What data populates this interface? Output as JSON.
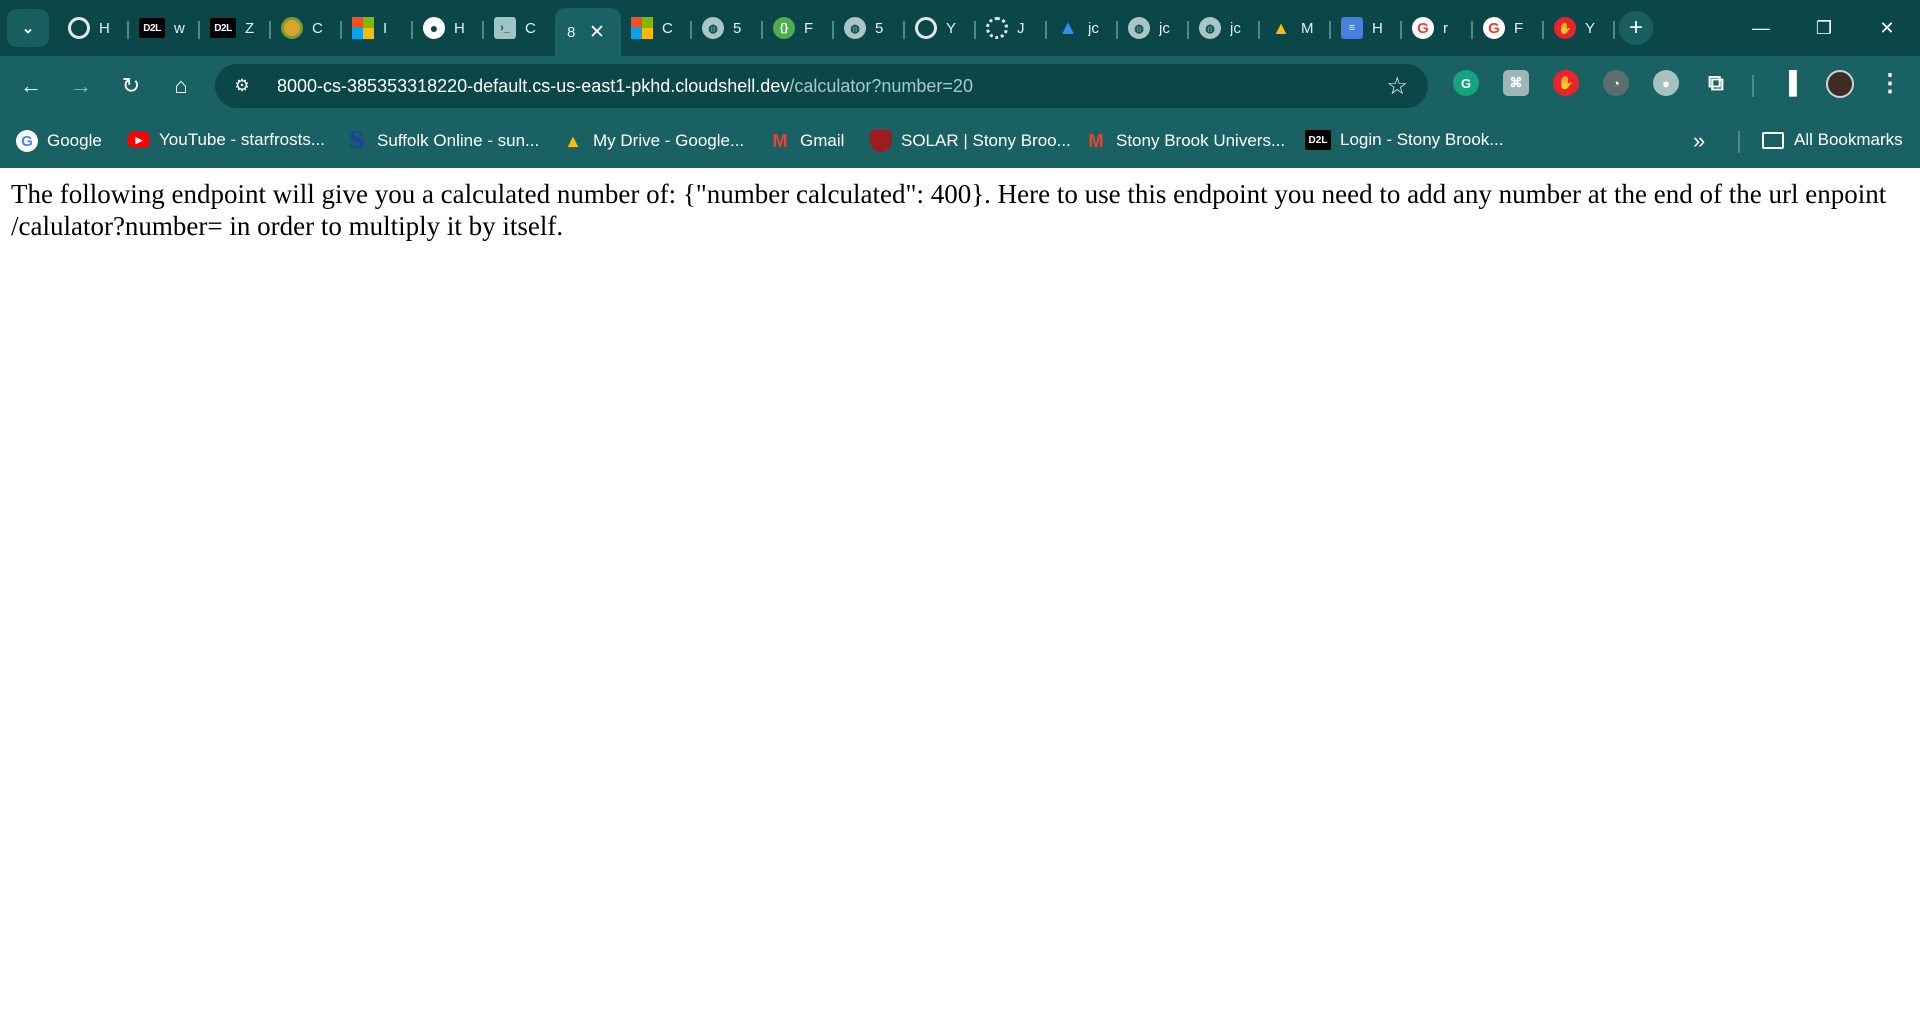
{
  "browser": {
    "tabs": [
      {
        "icon": "github-copilot-icon",
        "label": "H"
      },
      {
        "icon": "d2l-icon",
        "label": "w"
      },
      {
        "icon": "d2l-icon",
        "label": "Z"
      },
      {
        "icon": "target-icon",
        "label": "C"
      },
      {
        "icon": "microsoft-icon",
        "label": "I"
      },
      {
        "icon": "github-icon",
        "label": "H"
      },
      {
        "icon": "cloud-shell-icon",
        "label": "C"
      },
      {
        "icon": "none",
        "label": "8",
        "active": true
      },
      {
        "icon": "microsoft-icon",
        "label": "C"
      },
      {
        "icon": "globe-icon",
        "label": "5"
      },
      {
        "icon": "green-bracket-icon",
        "label": "F"
      },
      {
        "icon": "globe-icon",
        "label": "5"
      },
      {
        "icon": "github-copilot-icon",
        "label": "Y"
      },
      {
        "icon": "loading-ring-icon",
        "label": "J"
      },
      {
        "icon": "azure-icon",
        "label": "jc"
      },
      {
        "icon": "globe-icon",
        "label": "jc"
      },
      {
        "icon": "globe-icon",
        "label": "jc"
      },
      {
        "icon": "google-drive-icon",
        "label": "M"
      },
      {
        "icon": "google-docs-icon",
        "label": "H"
      },
      {
        "icon": "google-icon",
        "label": "r"
      },
      {
        "icon": "google-icon",
        "label": "F"
      },
      {
        "icon": "red-hand-icon",
        "label": "Y"
      }
    ],
    "close_glyph": "✕",
    "new_tab_glyph": "+",
    "window_controls": {
      "minimize": "—",
      "restore": "❐",
      "close": "✕"
    }
  },
  "toolbar": {
    "back": "←",
    "forward": "→",
    "reload": "↻",
    "home": "⌂",
    "url_host": "8000-cs-385353318220-default.cs-us-east1-pkhd.cloudshell.dev",
    "url_path": "/calculator?number=20",
    "star": "☆",
    "menu": "⋮"
  },
  "bookmarks": [
    {
      "icon": "google-icon",
      "label": "Google"
    },
    {
      "icon": "youtube-icon",
      "label": "YouTube - starfrosts..."
    },
    {
      "icon": "suffolk-icon",
      "label": "Suffolk Online - sun..."
    },
    {
      "icon": "google-drive-icon",
      "label": "My Drive - Google..."
    },
    {
      "icon": "gmail-icon",
      "label": "Gmail"
    },
    {
      "icon": "stony-brook-shield-icon",
      "label": "SOLAR | Stony Broo..."
    },
    {
      "icon": "gmail-icon",
      "label": "Stony Brook Univers..."
    },
    {
      "icon": "d2l-icon",
      "label": "Login - Stony Brook..."
    }
  ],
  "bookmarks_overflow": "»",
  "all_bookmarks_label": "All Bookmarks",
  "page": {
    "text": "The following endpoint will give you a calculated number of: {\"number calculated\": 400}. Here to use this endpoint you need to add any number at the end of the url enpoint /calulator?number= in order to multiply it by itself."
  }
}
